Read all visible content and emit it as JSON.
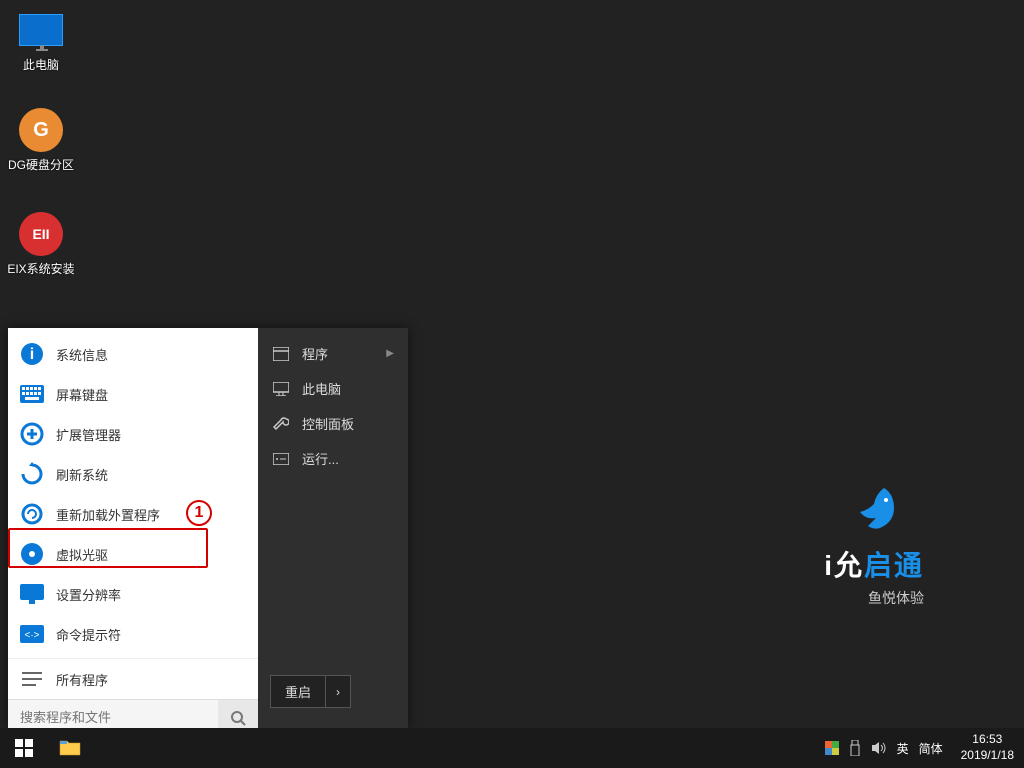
{
  "desktop": {
    "icons": [
      {
        "label": "此电脑",
        "name": "this-pc-icon"
      },
      {
        "label": "DG硬盘分区",
        "name": "dg-disk-partition-icon",
        "glyph": "G"
      },
      {
        "label": "EIX系统安装",
        "name": "eix-system-install-icon",
        "glyph": "EII"
      }
    ]
  },
  "start_menu": {
    "left_items": [
      {
        "label": "系统信息",
        "name": "system-info"
      },
      {
        "label": "屏幕键盘",
        "name": "on-screen-keyboard"
      },
      {
        "label": "扩展管理器",
        "name": "extension-manager"
      },
      {
        "label": "刷新系统",
        "name": "refresh-system"
      },
      {
        "label": "重新加载外置程序",
        "name": "reload-external-programs"
      },
      {
        "label": "虚拟光驱",
        "name": "virtual-cd-drive"
      },
      {
        "label": "设置分辨率",
        "name": "set-resolution"
      },
      {
        "label": "命令提示符",
        "name": "command-prompt"
      },
      {
        "label": "所有程序",
        "name": "all-programs"
      }
    ],
    "right_items": [
      {
        "label": "程序",
        "name": "programs",
        "arrow": true
      },
      {
        "label": "此电脑",
        "name": "this-pc"
      },
      {
        "label": "控制面板",
        "name": "control-panel"
      },
      {
        "label": "运行...",
        "name": "run"
      }
    ],
    "search_placeholder": "搜索程序和文件",
    "restart_label": "重启"
  },
  "brand": {
    "name_pre": "i允",
    "name_blue": "启通",
    "sub": "鱼悦体验"
  },
  "annotation": {
    "num": "1"
  },
  "taskbar": {
    "tray": {
      "lang1": "英",
      "lang2": "简体",
      "time": "16:53",
      "date": "2019/1/18"
    }
  }
}
